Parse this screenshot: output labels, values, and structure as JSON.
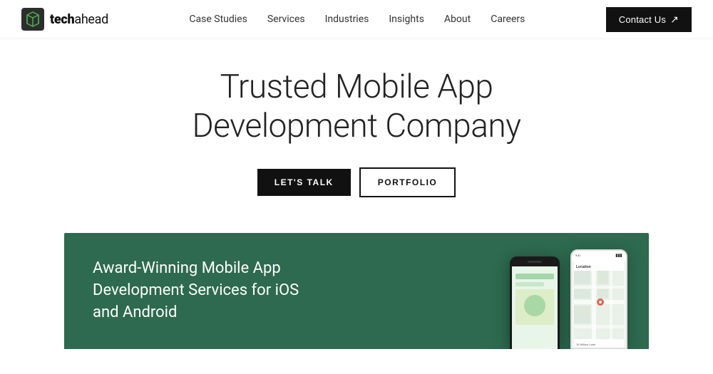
{
  "header": {
    "logo_text_bold": "tech",
    "logo_text_light": "ahead",
    "nav": {
      "items": [
        {
          "label": "Case Studies",
          "href": "#"
        },
        {
          "label": "Services",
          "href": "#"
        },
        {
          "label": "Industries",
          "href": "#"
        },
        {
          "label": "Insights",
          "href": "#"
        },
        {
          "label": "About",
          "href": "#"
        },
        {
          "label": "Careers",
          "href": "#"
        }
      ]
    },
    "contact_button": "Contact Us",
    "contact_arrow": "↗"
  },
  "hero": {
    "title": "Trusted Mobile App Development Company",
    "btn_talk": "LET'S TALK",
    "btn_portfolio": "PORTFOLIO"
  },
  "green_section": {
    "title": "Award-Winning Mobile App Development Services for iOS and Android"
  }
}
